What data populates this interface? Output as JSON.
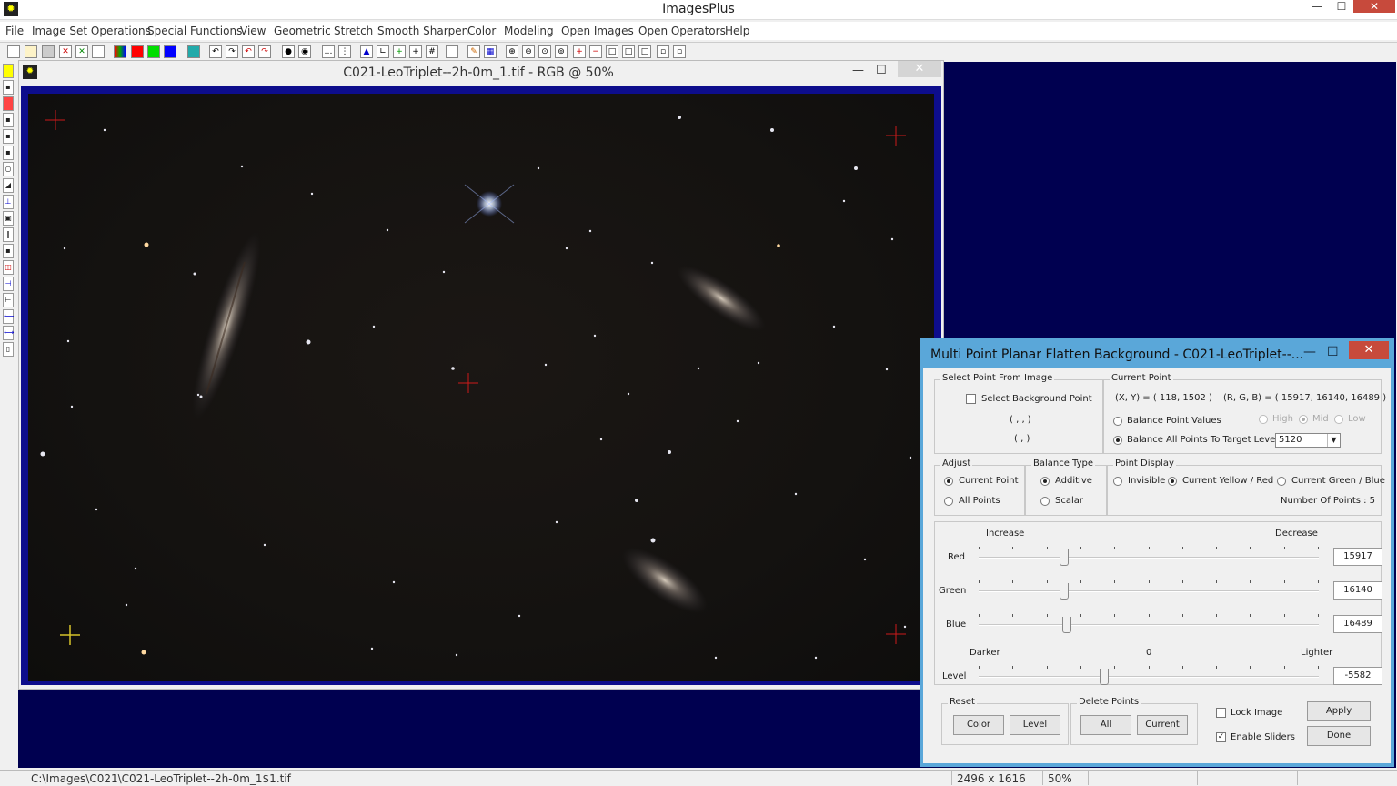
{
  "app": {
    "title": "ImagesPlus",
    "min": "—",
    "max": "☐",
    "close": "✕"
  },
  "menu": [
    "File",
    "Image Set Operations",
    "Special Functions",
    "View",
    "Geometric",
    "Stretch",
    "Smooth Sharpen",
    "Color",
    "Modeling",
    "Open Images",
    "Open Operators",
    "Help"
  ],
  "image_window": {
    "title": "C021-LeoTriplet--2h-0m_1.tif - RGB @ 50%",
    "min": "—",
    "max": "☐",
    "close": "✕"
  },
  "dialog": {
    "title": "Multi Point Planar Flatten Background - C021-LeoTriplet--...",
    "min": "—",
    "max": "☐",
    "close": "✕",
    "select_point": {
      "group": "Select Point From Image",
      "checkbox": "Select Background Point",
      "coord1": "( , , )",
      "coord2": "( , )"
    },
    "current_point": {
      "group": "Current Point",
      "xy": "(X, Y) = ( 118, 1502 )",
      "rgb": "(R, G, B) = ( 15917, 16140, 16489 )",
      "balance_point_values": "Balance Point Values",
      "high": "High",
      "mid": "Mid",
      "low": "Low",
      "balance_all": "Balance All Points To Target Level",
      "target_level": "5120"
    },
    "adjust": {
      "group": "Adjust",
      "current_point": "Current Point",
      "all_points": "All Points"
    },
    "balance_type": {
      "group": "Balance Type",
      "additive": "Additive",
      "scalar": "Scalar"
    },
    "point_display": {
      "group": "Point Display",
      "invisible": "Invisible",
      "current_yellow_red": "Current Yellow / Red",
      "current_green_blue": "Current Green / Blue",
      "number_of_points": "Number Of Points : 5"
    },
    "sliders": {
      "increase": "Increase",
      "decrease": "Decrease",
      "red_label": "Red",
      "green_label": "Green",
      "blue_label": "Blue",
      "red_value": "15917",
      "green_value": "16140",
      "blue_value": "16489",
      "red_pos": 0.25,
      "green_pos": 0.25,
      "blue_pos": 0.26
    },
    "level": {
      "darker": "Darker",
      "zero": "0",
      "lighter": "Lighter",
      "label": "Level",
      "value": "-5582",
      "pos": 0.37
    },
    "reset": {
      "group": "Reset",
      "color": "Color",
      "level": "Level"
    },
    "delete_points": {
      "group": "Delete Points",
      "all": "All",
      "current": "Current"
    },
    "lock_image": "Lock Image",
    "enable_sliders": "Enable Sliders",
    "enable_sliders_mark": "✓",
    "apply": "Apply",
    "done": "Done"
  },
  "status": {
    "path": "C:\\Images\\C021\\C021-LeoTriplet--2h-0m_1$1.tif",
    "dimensions": "2496 x 1616",
    "zoom": "50%"
  }
}
